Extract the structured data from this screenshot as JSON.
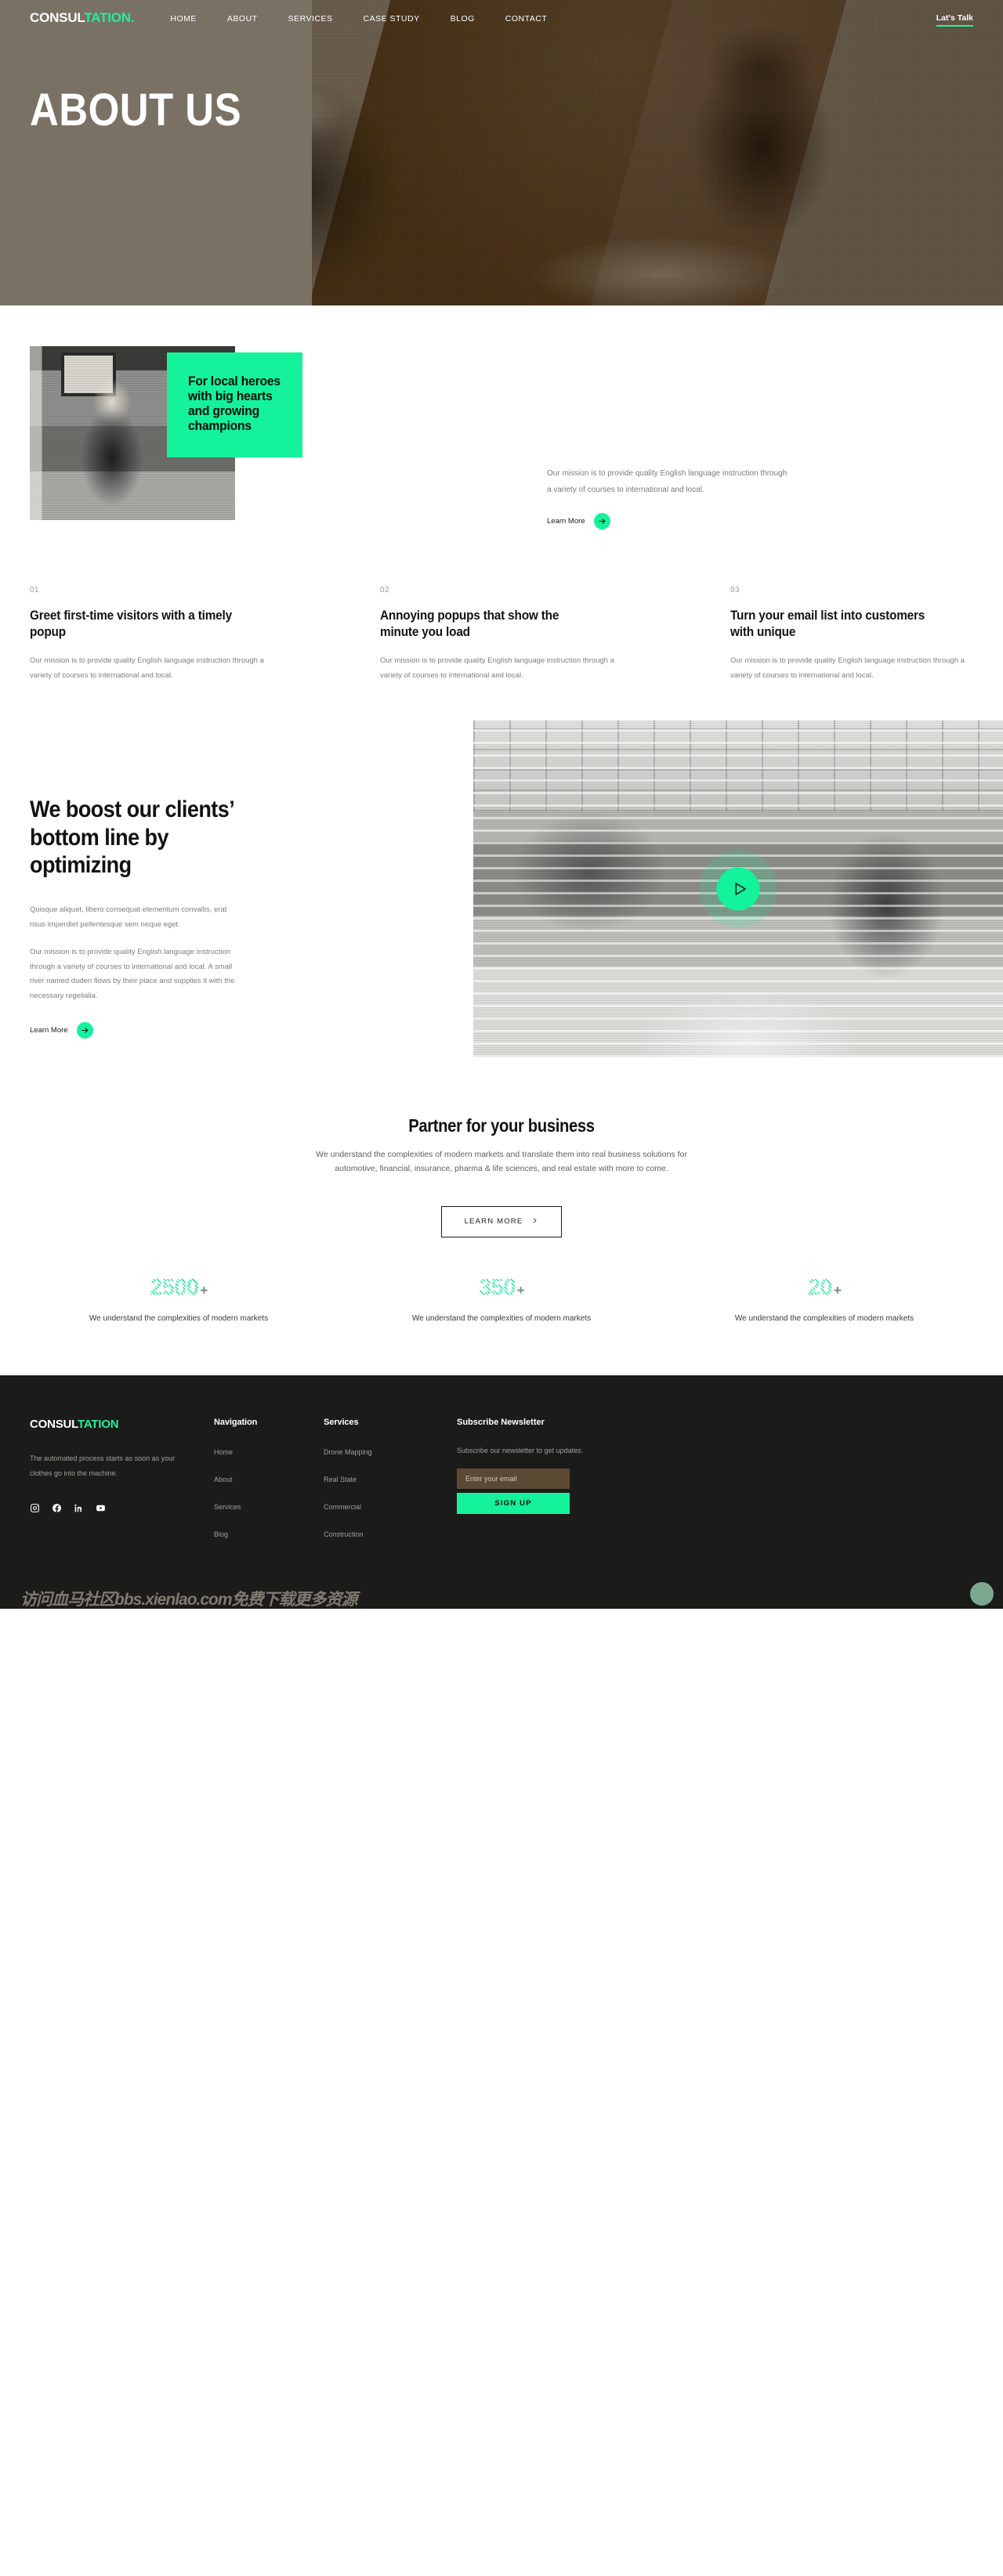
{
  "brand": {
    "part1": "CONSUL",
    "part2": "TATION",
    "dot": "."
  },
  "nav": {
    "links": [
      {
        "label": "HOME"
      },
      {
        "label": "ABOUT"
      },
      {
        "label": "SERVICES"
      },
      {
        "label": "CASE STUDY"
      },
      {
        "label": "BLOG"
      },
      {
        "label": "CONTACT"
      }
    ],
    "cta": "Lat's Talk"
  },
  "hero": {
    "title": "ABOUT US"
  },
  "intro": {
    "card_heading": "For local heroes with big hearts and growing champions",
    "paragraph": "Our mission is to provide quality English language instruction through a variety of courses to international and local.",
    "learn_more": "Learn More",
    "arrow_icon": "arrow-right-icon"
  },
  "features": [
    {
      "num": "01",
      "title": "Greet first-time visitors with a timely popup",
      "body": "Our mission is to provide quality English language instruction through a variety of courses to international and local."
    },
    {
      "num": "02",
      "title": "Annoying popups that show the minute you load",
      "body": "Our mission is to provide quality English language instruction through a variety of courses to international and local."
    },
    {
      "num": "03",
      "title": "Turn your email list into customers with unique",
      "body": "Our mission is to provide quality English language instruction through a variety of courses to international and local."
    }
  ],
  "boost": {
    "heading": "We boost our clients’ bottom line by optimizing",
    "para1": "Quisque aliquet, libero consequat elementum convallis, erat risus imperdiet pellentesque sem neque eget.",
    "para2": "Our mission is to provide quality English language instruction through a variety of courses to international and local. A small river named duden flows by their place and supplies it with the necessary regelialia.",
    "learn_more": "Learn More",
    "play_icon": "play-icon"
  },
  "partner": {
    "heading": "Partner for your business",
    "body": "We understand the complexities of modern markets and translate them into real business solutions for automotive, financial, insurance, pharma & life sciences, and real estate with more to come.",
    "button": "LEARN MORE",
    "button_icon": "chevron-right-icon"
  },
  "stats": [
    {
      "value": "2500",
      "suffix": "+",
      "caption": "We understand the complexities of modern markets"
    },
    {
      "value": "350",
      "suffix": "+",
      "caption": "We understand the complexities of modern markets"
    },
    {
      "value": "20",
      "suffix": "+",
      "caption": "We understand the complexities of modern markets"
    }
  ],
  "footer": {
    "brand": {
      "part1": "CONSUL",
      "part2": "TATION"
    },
    "tagline": "The automated process starts as soon as your clothes go into the machine.",
    "socials": [
      {
        "name": "instagram-icon"
      },
      {
        "name": "facebook-icon"
      },
      {
        "name": "linkedin-icon"
      },
      {
        "name": "youtube-icon"
      }
    ],
    "navigation": {
      "heading": "Navigation",
      "items": [
        {
          "label": "Home"
        },
        {
          "label": "About"
        },
        {
          "label": "Services"
        },
        {
          "label": "Blog"
        }
      ]
    },
    "services": {
      "heading": "Services",
      "items": [
        {
          "label": "Drone Mapping"
        },
        {
          "label": "Real State"
        },
        {
          "label": "Commercial"
        },
        {
          "label": "Construction"
        }
      ]
    },
    "newsletter": {
      "heading": "Subscribe Newsletter",
      "body": "Subscribe our newsletter to get updates.",
      "placeholder": "Enter your email",
      "value": "",
      "button": "SIGN UP"
    },
    "watermark": "访问血马社区bbs.xienlao.com免费下载更多资源"
  },
  "colors": {
    "accent": "#14f29b",
    "dark": "#1b1b19",
    "muted": "#7e7e7e"
  }
}
